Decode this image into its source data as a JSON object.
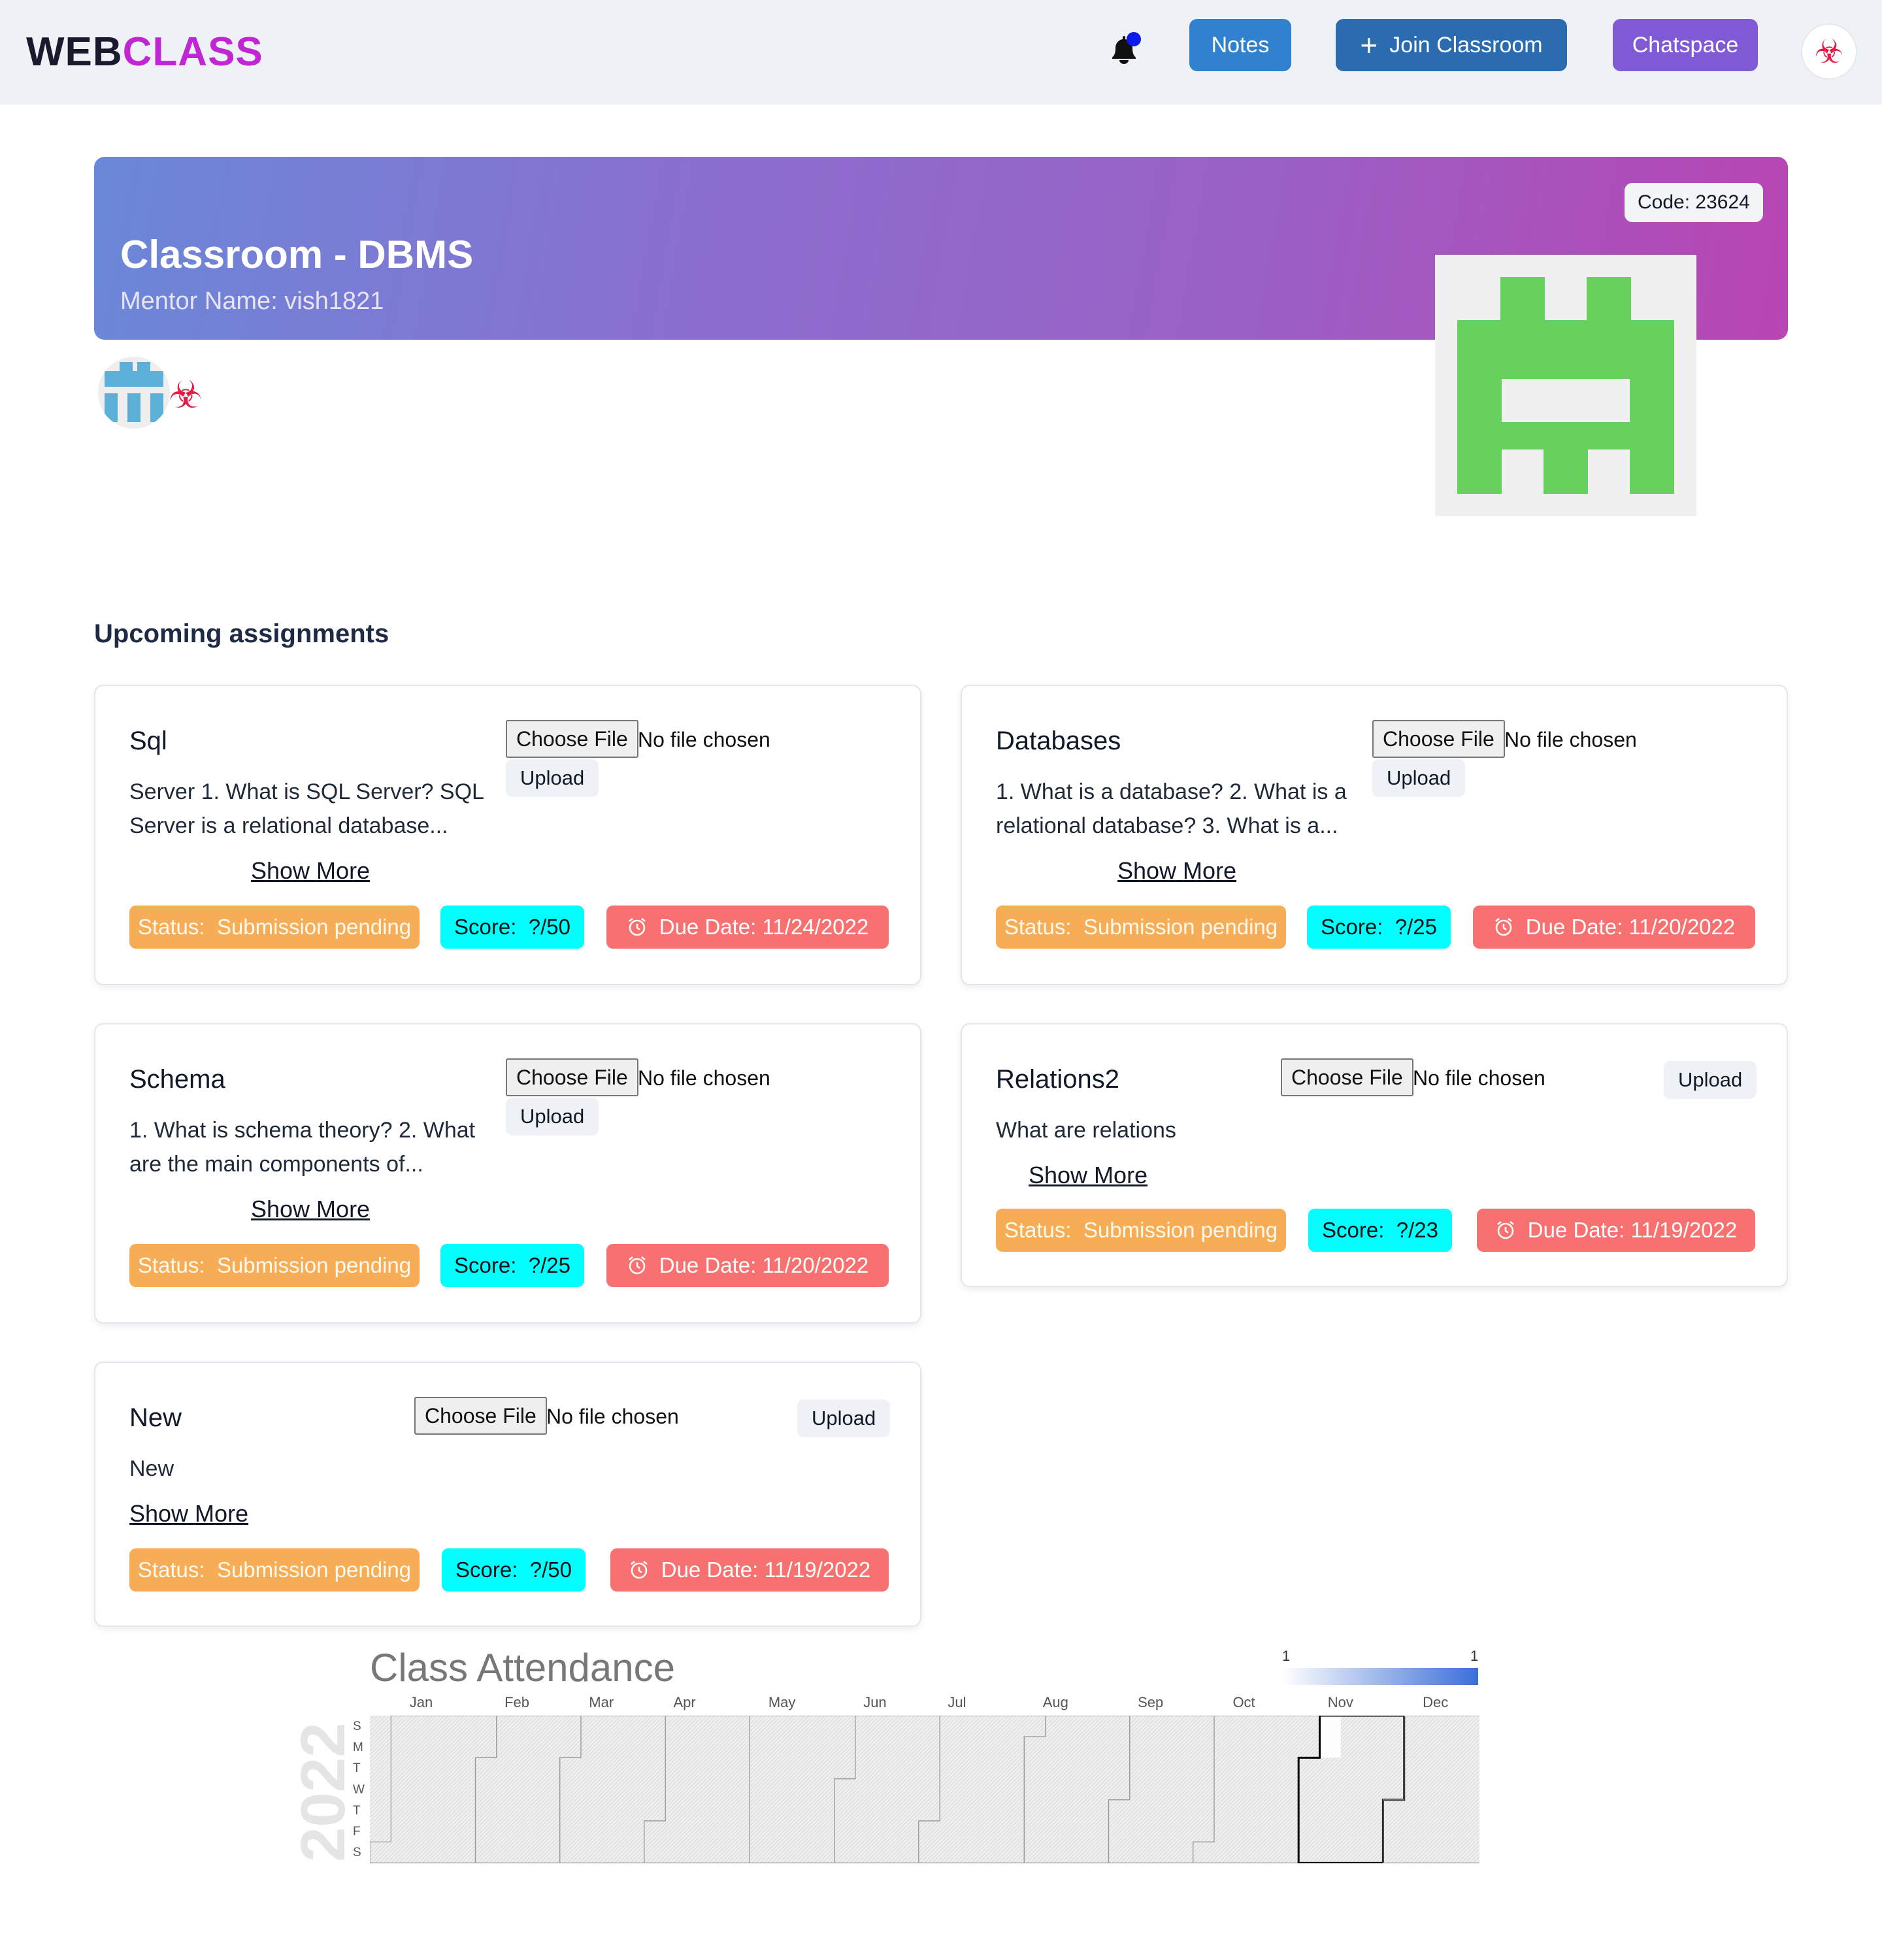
{
  "brand": {
    "part1": "WEB",
    "part2": "CLASS"
  },
  "nav": {
    "notes_label": "Notes",
    "join_label": "Join Classroom",
    "chat_label": "Chatspace",
    "notes_color": "#3182ce",
    "join_color": "#2b6cb0",
    "chat_color": "#805ad5"
  },
  "classroom": {
    "title": "Classroom - DBMS",
    "mentor": "Mentor Name: vish1821",
    "code": "Code: 23624"
  },
  "section_title": "Upcoming assignments",
  "file_input": {
    "button": "Choose File",
    "status": "No file chosen"
  },
  "upload_label": "Upload",
  "show_more_label": "Show More",
  "status_prefix": "Status:",
  "score_prefix": "Score:",
  "due_prefix": "Due Date:",
  "assignments": [
    {
      "title": "Sql",
      "desc_line1": "Server 1. What is SQL Server? SQL",
      "desc_line2": "Server is a relational database...",
      "status": "Submission pending",
      "score": "?/50",
      "due": "11/24/2022"
    },
    {
      "title": "Databases",
      "desc_line1": "1. What is a database? 2. What is a",
      "desc_line2": "relational database? 3. What is a...",
      "status": "Submission pending",
      "score": "?/25",
      "due": "11/20/2022"
    },
    {
      "title": "Schema",
      "desc_line1": "1. What is schema theory? 2. What",
      "desc_line2": "are the main components of...",
      "status": "Submission pending",
      "score": "?/25",
      "due": "11/20/2022"
    },
    {
      "title": "Relations2",
      "desc_line1": "What are relations",
      "desc_line2": "",
      "status": "Submission pending",
      "score": "?/23",
      "due": "11/19/2022"
    },
    {
      "title": "New",
      "desc_line1": "New",
      "desc_line2": "",
      "status": "Submission pending",
      "score": "?/50",
      "due": "11/19/2022"
    }
  ],
  "attendance": {
    "title": "Class Attendance",
    "year": "2022",
    "legend_min": "1",
    "legend_max": "1",
    "months": [
      "Jan",
      "Feb",
      "Mar",
      "Apr",
      "May",
      "Jun",
      "Jul",
      "Aug",
      "Sep",
      "Oct",
      "Nov",
      "Dec"
    ],
    "days": [
      "S",
      "M",
      "T",
      "W",
      "T",
      "F",
      "S"
    ],
    "highlight_month": "Nov"
  }
}
